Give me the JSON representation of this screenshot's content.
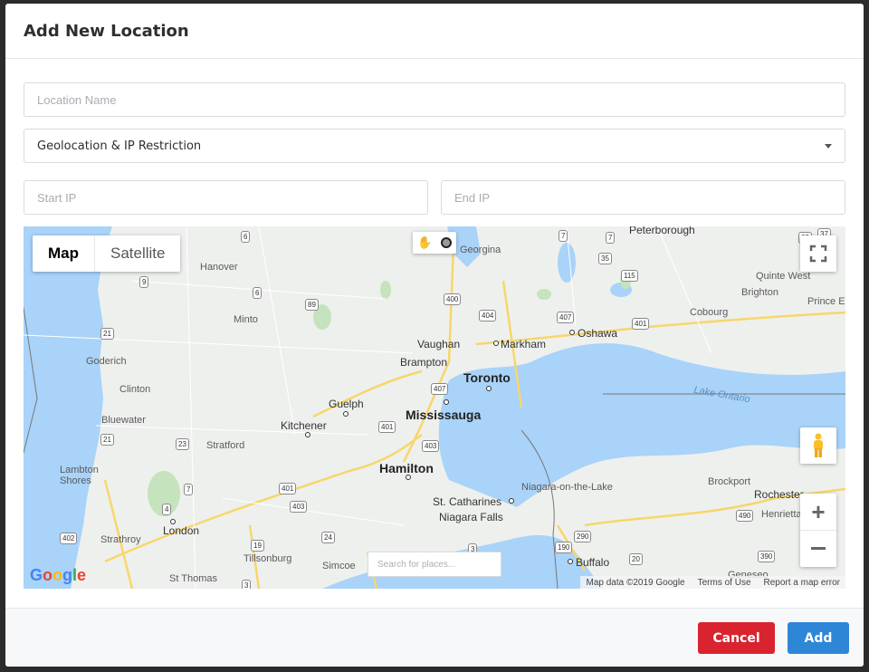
{
  "modal": {
    "title": "Add New Location"
  },
  "form": {
    "location_name_placeholder": "Location Name",
    "restriction_type": "Geolocation & IP Restriction",
    "start_ip_placeholder": "Start IP",
    "end_ip_placeholder": "End IP"
  },
  "map": {
    "type_map": "Map",
    "type_satellite": "Satellite",
    "search_placeholder": "Search for places...",
    "logo": "Google",
    "attribution": {
      "data": "Map data ©2019 Google",
      "terms": "Terms of Use",
      "report": "Report a map error"
    },
    "places": {
      "peterborough": "Peterborough",
      "georgina": "Georgina",
      "hanover": "Hanover",
      "quinte_west": "Quinte West",
      "brighton": "Brighton",
      "prince_e": "Prince E",
      "minto": "Minto",
      "cobourg": "Cobourg",
      "vaughan": "Vaughan",
      "markham": "Markham",
      "oshawa": "Oshawa",
      "goderich": "Goderich",
      "brampton": "Brampton",
      "toronto": "Toronto",
      "clinton": "Clinton",
      "guelph": "Guelph",
      "lake_ontario": "Lake Ontario",
      "bluewater": "Bluewater",
      "kitchener": "Kitchener",
      "mississauga": "Mississauga",
      "stratford": "Stratford",
      "lambton_shores": "Lambton\nShores",
      "hamilton": "Hamilton",
      "niagara_on_the_lake": "Niagara-on-the-Lake",
      "brockport": "Brockport",
      "st_catharines": "St. Catharines",
      "rochester": "Rochester",
      "henrietta": "Henrietta",
      "niagara_falls": "Niagara Falls",
      "london": "London",
      "strathroy": "Strathroy",
      "tillsonburg": "Tillsonburg",
      "simcoe": "Simcoe",
      "buffalo": "Buffalo",
      "geneseo": "Geneseo",
      "st_thomas": "St Thomas"
    },
    "shields": [
      "6",
      "7",
      "7",
      "9",
      "6",
      "89",
      "400",
      "404",
      "407",
      "401",
      "35",
      "115",
      "21",
      "21",
      "407",
      "401",
      "403",
      "23",
      "7",
      "4",
      "401",
      "403",
      "402",
      "19",
      "24",
      "3",
      "3",
      "190",
      "290",
      "20",
      "490",
      "390",
      "62",
      "37"
    ],
    "colors": {
      "water": "#a9d3f8",
      "land": "#eef0ee",
      "highway": "#f7d66b",
      "park": "#c5e3bc"
    }
  },
  "footer": {
    "cancel_label": "Cancel",
    "add_label": "Add"
  }
}
